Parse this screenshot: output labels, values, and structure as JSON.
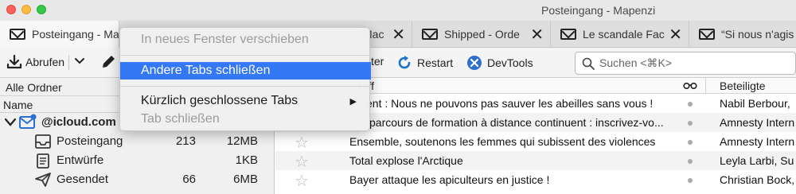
{
  "window": {
    "title": "Posteingang - Mapenzi"
  },
  "tabs": [
    {
      "label": "Posteingang - Ma",
      "active": true,
      "closable": false
    },
    {
      "label": "Mac",
      "active": false,
      "closable": true
    },
    {
      "label": "Shipped - Orde",
      "active": false,
      "closable": true
    },
    {
      "label": "Le scandale Fac",
      "active": false,
      "closable": true
    },
    {
      "label": "“Si nous n'agis",
      "active": false,
      "closable": false
    }
  ],
  "tab_close_glyph": "✕",
  "toolbar": {
    "get_messages": "Abrufen",
    "filter_partial": "ter",
    "restart": "Restart",
    "devtools": "DevTools",
    "search_placeholder": "Suchen <⌘K>"
  },
  "folder_pane": {
    "selector": "Alle Ordner",
    "column_name": "Name",
    "account": "@icloud.com",
    "folders": [
      {
        "name": "Posteingang",
        "unread": "213",
        "size": "12MB",
        "icon": "inbox-icon"
      },
      {
        "name": "Entwürfe",
        "unread": "",
        "size": "1KB",
        "icon": "drafts-icon"
      },
      {
        "name": "Gesendet",
        "unread": "66",
        "size": "6MB",
        "icon": "sent-icon"
      }
    ]
  },
  "message_list": {
    "col_subject_partial": "reff",
    "col_correspondents": "Beteiligte",
    "rows": [
      {
        "subject": "ent : Nous ne pouvons pas sauver les abeilles sans vous !",
        "correspondent": "Nabil Berbour,",
        "starred": false
      },
      {
        "subject": "parcours de formation à distance continuent : inscrivez-vo...",
        "correspondent": "Amnesty Intern",
        "starred": false
      },
      {
        "subject": "Ensemble, soutenons les femmes qui subissent des violences",
        "correspondent": "Amnesty Intern",
        "starred": false
      },
      {
        "subject": "Total explose l'Arctique",
        "correspondent": "Leyla Larbi, Su",
        "starred": false
      },
      {
        "subject": "Bayer attaque les apiculteurs en justice !",
        "correspondent": "Christian Bock,",
        "starred": false
      }
    ]
  },
  "context_menu": {
    "items": [
      {
        "label": "In neues Fenster verschieben",
        "disabled": true
      },
      {
        "label": "Andere Tabs schließen",
        "highlighted": true
      },
      {
        "label": "Kürzlich geschlossene Tabs",
        "has_submenu": true
      },
      {
        "label": "Tab schließen",
        "disabled": true
      }
    ]
  },
  "colors": {
    "accent": "#3478f6",
    "restart_icon": "#1a73c9",
    "devtools_icon": "#2e6fd0",
    "account_icon": "#2a6fd8"
  }
}
